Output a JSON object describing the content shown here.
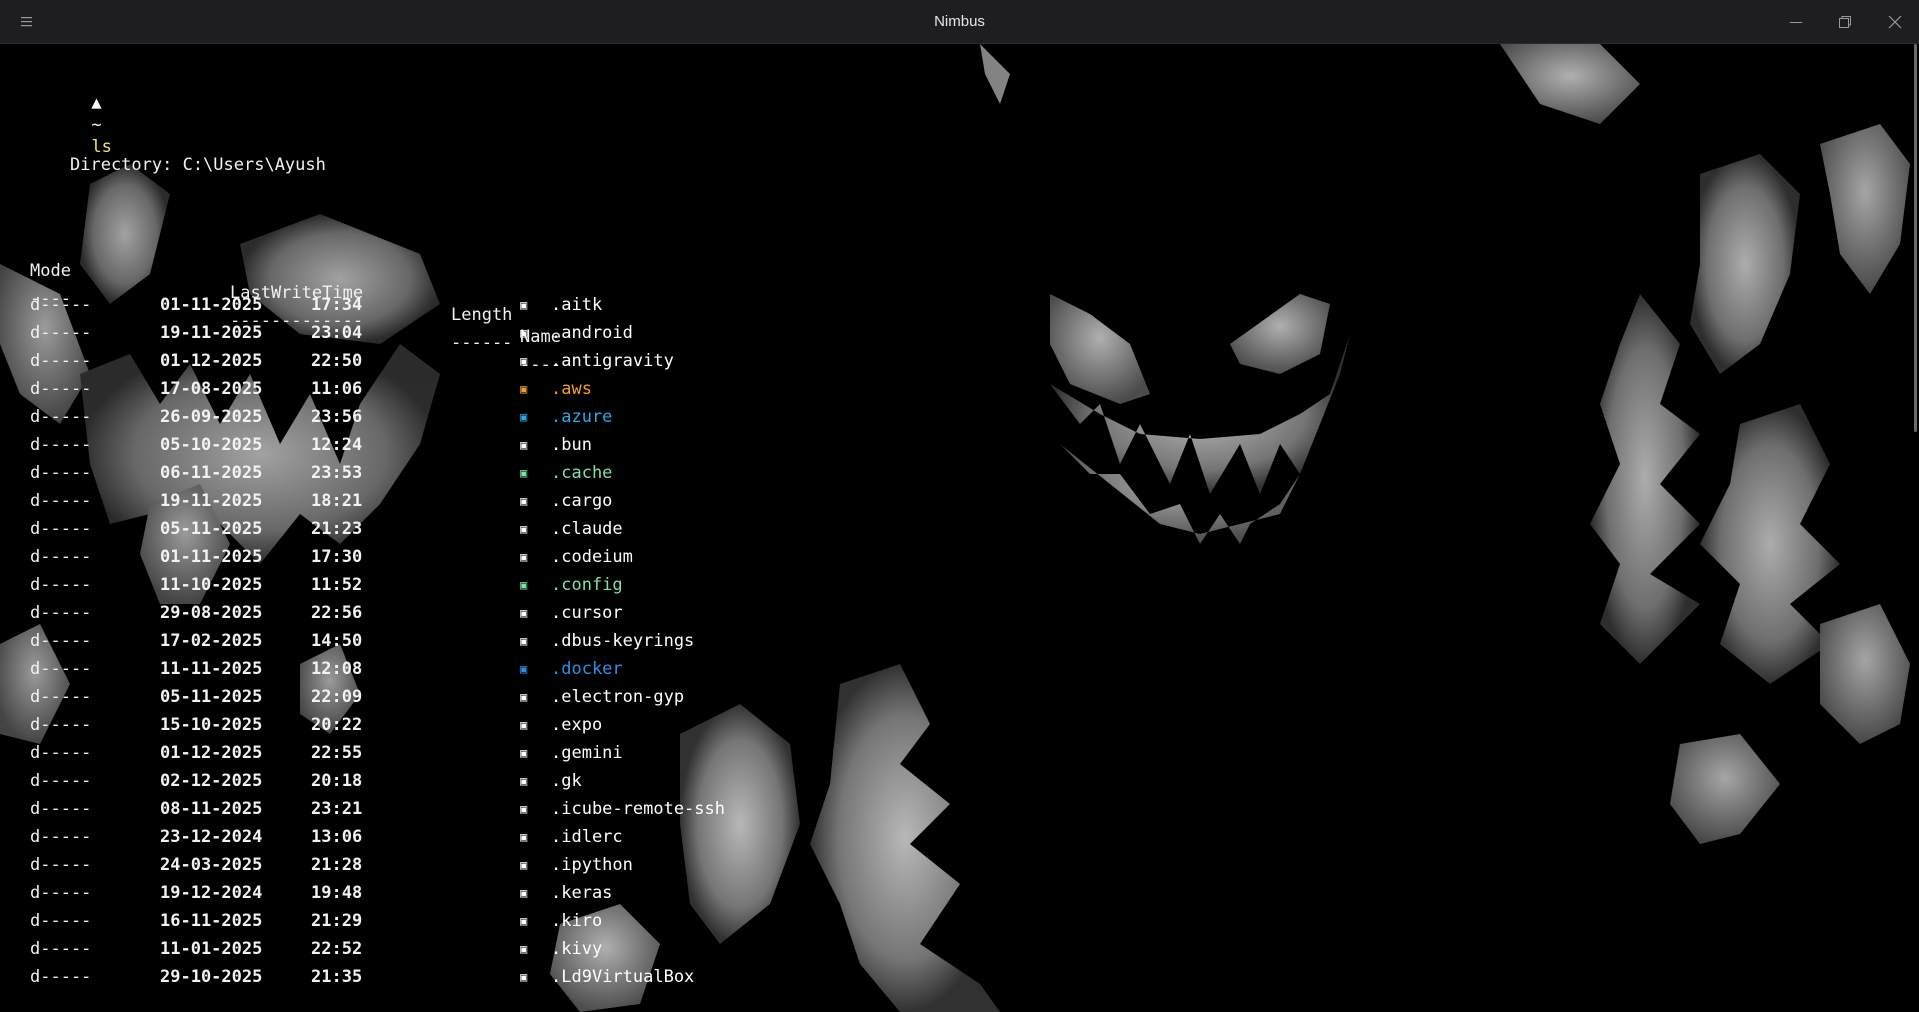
{
  "window": {
    "title": "Nimbus",
    "menu_icon": "hamburger-menu-icon",
    "controls": [
      "minimize-icon",
      "restore-icon",
      "close-icon"
    ]
  },
  "terminal": {
    "prompt": {
      "symbol": "▲",
      "path": "~",
      "command": "ls"
    },
    "directory_line": "Directory: C:\\Users\\Ayush",
    "headers": {
      "mode": "Mode",
      "last_write_time": "LastWriteTime",
      "length": "Length",
      "name": "Name"
    },
    "separators": {
      "mode": "----",
      "last_write_time": "-------------",
      "length": "------",
      "name": "----"
    },
    "entries": [
      {
        "mode": "d-----",
        "date": "01-11-2025",
        "time": "17:34",
        "icon": "▣",
        "name": ".aitk",
        "color": "#ffffff"
      },
      {
        "mode": "d-----",
        "date": "19-11-2025",
        "time": "23:04",
        "icon": "▣",
        "name": ".android",
        "color": "#ffffff"
      },
      {
        "mode": "d-----",
        "date": "01-12-2025",
        "time": "22:50",
        "icon": "▣",
        "name": ".antigravity",
        "color": "#ffffff"
      },
      {
        "mode": "d-----",
        "date": "17-08-2025",
        "time": "11:06",
        "icon": "▣",
        "name": ".aws",
        "color": "#f0a030"
      },
      {
        "mode": "d-----",
        "date": "26-09-2025",
        "time": "23:56",
        "icon": "▣",
        "name": ".azure",
        "color": "#2aa8e8"
      },
      {
        "mode": "d-----",
        "date": "05-10-2025",
        "time": "12:24",
        "icon": "▣",
        "name": ".bun",
        "color": "#ffffff"
      },
      {
        "mode": "d-----",
        "date": "06-11-2025",
        "time": "23:53",
        "icon": "▣",
        "name": ".cache",
        "color": "#7fe0a8"
      },
      {
        "mode": "d-----",
        "date": "19-11-2025",
        "time": "18:21",
        "icon": "▣",
        "name": ".cargo",
        "color": "#ffffff"
      },
      {
        "mode": "d-----",
        "date": "05-11-2025",
        "time": "21:23",
        "icon": "▣",
        "name": ".claude",
        "color": "#ffffff"
      },
      {
        "mode": "d-----",
        "date": "01-11-2025",
        "time": "17:30",
        "icon": "▣",
        "name": ".codeium",
        "color": "#ffffff"
      },
      {
        "mode": "d-----",
        "date": "11-10-2025",
        "time": "11:52",
        "icon": "▣",
        "name": ".config",
        "color": "#7fe0a8"
      },
      {
        "mode": "d-----",
        "date": "29-08-2025",
        "time": "22:56",
        "icon": "▣",
        "name": ".cursor",
        "color": "#ffffff"
      },
      {
        "mode": "d-----",
        "date": "17-02-2025",
        "time": "14:50",
        "icon": "▣",
        "name": ".dbus-keyrings",
        "color": "#ffffff"
      },
      {
        "mode": "d-----",
        "date": "11-11-2025",
        "time": "12:08",
        "icon": "▣",
        "name": ".docker",
        "color": "#2f8fe6"
      },
      {
        "mode": "d-----",
        "date": "05-11-2025",
        "time": "22:09",
        "icon": "▣",
        "name": ".electron-gyp",
        "color": "#ffffff"
      },
      {
        "mode": "d-----",
        "date": "15-10-2025",
        "time": "20:22",
        "icon": "▣",
        "name": ".expo",
        "color": "#ffffff"
      },
      {
        "mode": "d-----",
        "date": "01-12-2025",
        "time": "22:55",
        "icon": "▣",
        "name": ".gemini",
        "color": "#ffffff"
      },
      {
        "mode": "d-----",
        "date": "02-12-2025",
        "time": "20:18",
        "icon": "▣",
        "name": ".gk",
        "color": "#ffffff"
      },
      {
        "mode": "d-----",
        "date": "08-11-2025",
        "time": "23:21",
        "icon": "▣",
        "name": ".icube-remote-ssh",
        "color": "#ffffff"
      },
      {
        "mode": "d-----",
        "date": "23-12-2024",
        "time": "13:06",
        "icon": "▣",
        "name": ".idlerc",
        "color": "#ffffff"
      },
      {
        "mode": "d-----",
        "date": "24-03-2025",
        "time": "21:28",
        "icon": "▣",
        "name": ".ipython",
        "color": "#ffffff"
      },
      {
        "mode": "d-----",
        "date": "19-12-2024",
        "time": "19:48",
        "icon": "▣",
        "name": ".keras",
        "color": "#ffffff"
      },
      {
        "mode": "d-----",
        "date": "16-11-2025",
        "time": "21:29",
        "icon": "▣",
        "name": ".kiro",
        "color": "#ffffff"
      },
      {
        "mode": "d-----",
        "date": "11-01-2025",
        "time": "22:52",
        "icon": "▣",
        "name": ".kivy",
        "color": "#ffffff"
      },
      {
        "mode": "d-----",
        "date": "29-10-2025",
        "time": "21:35",
        "icon": "▣",
        "name": ".Ld9VirtualBox",
        "color": "#ffffff"
      }
    ]
  },
  "colors": {
    "background": "#000000",
    "titlebar": "#1e1e22",
    "command": "#f5e36b",
    "text": "#f2f2f2"
  }
}
